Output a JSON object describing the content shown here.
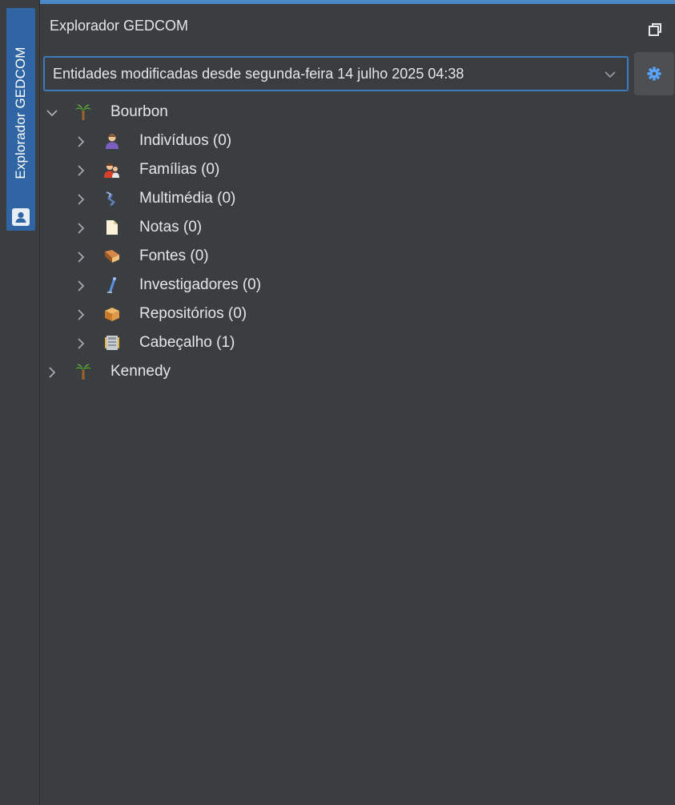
{
  "sidebar": {
    "tab_label": "Explorador GEDCOM",
    "tab_icon": "user-card-icon",
    "accent": "#2f65a3"
  },
  "panel": {
    "title": "Explorador GEDCOM",
    "restore_icon": "restore-window-icon"
  },
  "filter": {
    "selected": "Entidades modificadas desde segunda-feira 14 julho 2025 04:38",
    "border_color": "#3d7bbf"
  },
  "settings": {
    "icon": "gear-icon",
    "color": "#5aa3ff"
  },
  "tree": {
    "root1": {
      "label": "Bourbon",
      "icon": "palm-tree-icon",
      "expanded": true,
      "children": [
        {
          "label": "Indivíduos (0)",
          "icon": "individual-icon"
        },
        {
          "label": "Famílias (0)",
          "icon": "family-icon"
        },
        {
          "label": "Multimédia (0)",
          "icon": "multimedia-icon"
        },
        {
          "label": "Notas (0)",
          "icon": "note-icon"
        },
        {
          "label": "Fontes (0)",
          "icon": "source-book-icon"
        },
        {
          "label": "Investigadores (0)",
          "icon": "researcher-pen-icon"
        },
        {
          "label": "Repositórios (0)",
          "icon": "repository-box-icon"
        },
        {
          "label": "Cabeçalho (1)",
          "icon": "header-icon"
        }
      ]
    },
    "root2": {
      "label": "Kennedy",
      "icon": "palm-tree-icon",
      "expanded": false
    }
  }
}
